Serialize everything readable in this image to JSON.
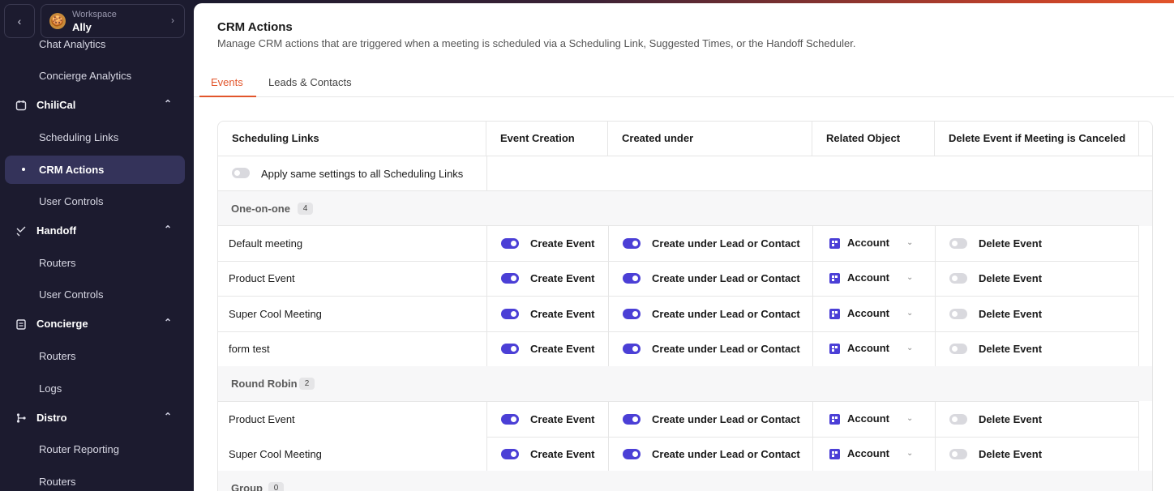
{
  "workspace": {
    "label": "Workspace",
    "name": "Ally"
  },
  "sidebar": {
    "items": [
      {
        "type": "sub",
        "label": "Chat Analytics"
      },
      {
        "type": "sub",
        "label": "Concierge Analytics"
      },
      {
        "type": "section",
        "label": "ChiliCal",
        "icon": "calendar-icon"
      },
      {
        "type": "sub",
        "label": "Scheduling Links"
      },
      {
        "type": "active",
        "label": "CRM Actions"
      },
      {
        "type": "sub",
        "label": "User Controls"
      },
      {
        "type": "section",
        "label": "Handoff",
        "icon": "handoff-icon"
      },
      {
        "type": "sub",
        "label": "Routers"
      },
      {
        "type": "sub",
        "label": "User Controls"
      },
      {
        "type": "section",
        "label": "Concierge",
        "icon": "clipboard-icon"
      },
      {
        "type": "sub",
        "label": "Routers"
      },
      {
        "type": "sub",
        "label": "Logs"
      },
      {
        "type": "section",
        "label": "Distro",
        "icon": "branch-icon"
      },
      {
        "type": "sub",
        "label": "Router Reporting"
      },
      {
        "type": "sub",
        "label": "Routers"
      }
    ]
  },
  "page": {
    "title": "CRM Actions",
    "description": "Manage CRM actions that are triggered when a meeting is scheduled via a Scheduling Link, Suggested Times, or the Handoff Scheduler."
  },
  "tabs": [
    {
      "label": "Events",
      "active": true
    },
    {
      "label": "Leads & Contacts",
      "active": false
    }
  ],
  "table": {
    "headers": [
      "Scheduling Links",
      "Event Creation",
      "Created under",
      "Related Object",
      "Delete Event if Meeting is Canceled"
    ],
    "apply_all_label": "Apply same settings to all Scheduling Links",
    "groups": [
      {
        "name": "One-on-one",
        "count": "4",
        "rows": [
          {
            "name": "Default meeting",
            "event": "Create Event",
            "created_under": "Create under Lead or Contact",
            "related": "Account",
            "delete": "Delete Event"
          },
          {
            "name": "Product Event",
            "event": "Create Event",
            "created_under": "Create under Lead or Contact",
            "related": "Account",
            "delete": "Delete Event"
          },
          {
            "name": "Super Cool Meeting",
            "event": "Create Event",
            "created_under": "Create under Lead or Contact",
            "related": "Account",
            "delete": "Delete Event"
          },
          {
            "name": "form test",
            "event": "Create Event",
            "created_under": "Create under Lead or Contact",
            "related": "Account",
            "delete": "Delete Event"
          }
        ]
      },
      {
        "name": "Round Robin",
        "count": "2",
        "rows": [
          {
            "name": "Product Event",
            "event": "Create Event",
            "created_under": "Create under Lead or Contact",
            "related": "Account",
            "delete": "Delete Event"
          },
          {
            "name": "Super Cool Meeting",
            "event": "Create Event",
            "created_under": "Create under Lead or Contact",
            "related": "Account",
            "delete": "Delete Event"
          }
        ]
      },
      {
        "name": "Group",
        "count": "0",
        "rows": []
      }
    ]
  },
  "colors": {
    "accent": "#e2552b",
    "toggle_on": "#4b3fd6",
    "sidebar_bg": "#1c1b2f"
  }
}
